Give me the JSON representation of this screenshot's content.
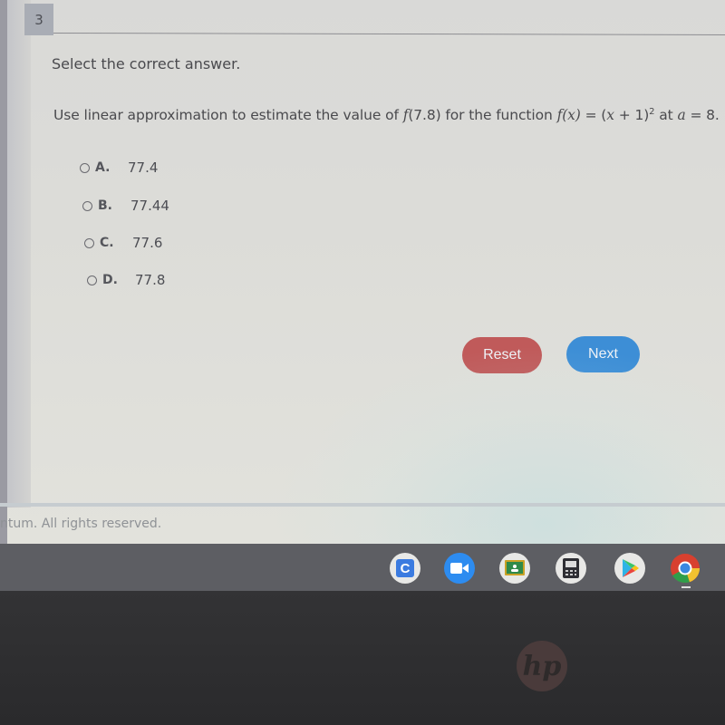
{
  "question": {
    "number": "3",
    "instruction": "Select the correct answer.",
    "prompt_prefix": "Use linear approximation to estimate the value of ",
    "prompt_f1": "f",
    "prompt_arg": "(7.8) for the function ",
    "prompt_f2": "f",
    "prompt_x": "(x)",
    "prompt_eq": " = (",
    "prompt_x2": "x",
    "prompt_plus": " + 1)",
    "prompt_exp": "2",
    "prompt_at": " at ",
    "prompt_a": "a",
    "prompt_end": " = 8."
  },
  "options": [
    {
      "letter": "A.",
      "value": "77.4",
      "selected": false
    },
    {
      "letter": "B.",
      "value": "77.44",
      "selected": false
    },
    {
      "letter": "C.",
      "value": "77.6",
      "selected": false
    },
    {
      "letter": "D.",
      "value": "77.8",
      "selected": false
    }
  ],
  "buttons": {
    "reset_label": "Reset",
    "next_label": "Next",
    "reset_color": "#c05a5a",
    "next_color": "#3d8ed6"
  },
  "footer": {
    "copyright": "ntum. All rights reserved."
  },
  "shelf": {
    "apps": [
      {
        "name": "classroom-c-icon",
        "glyph": "C"
      },
      {
        "name": "video-camera-icon",
        "glyph": "▶"
      },
      {
        "name": "google-classroom-icon",
        "glyph": "▣"
      },
      {
        "name": "calculator-icon",
        "glyph": "▦"
      },
      {
        "name": "play-store-icon",
        "glyph": "▶"
      },
      {
        "name": "chrome-icon",
        "glyph": "●"
      }
    ]
  },
  "device": {
    "brand_logo": "hp"
  }
}
